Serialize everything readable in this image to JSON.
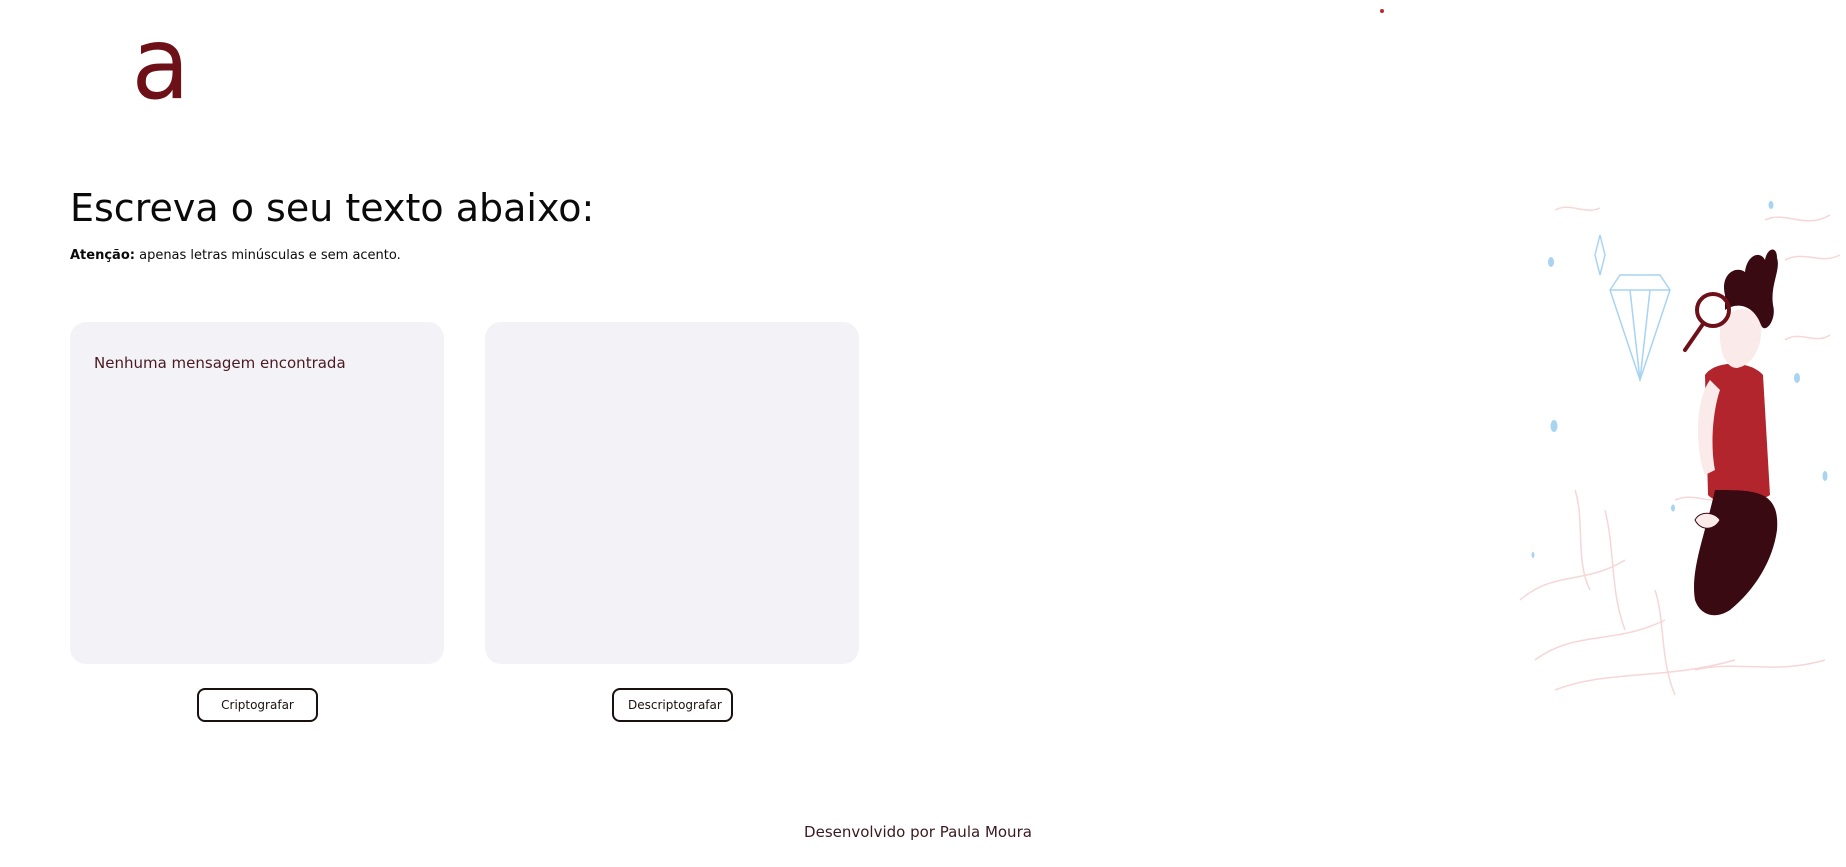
{
  "logo": {
    "text": "a"
  },
  "main": {
    "title": "Escreva o seu texto abaixo:",
    "notice_label": "Atenção:",
    "notice_text": " apenas letras minúsculas e sem acento."
  },
  "panels": {
    "left_text": "Nenhuma mensagem encontrada",
    "right_text": ""
  },
  "buttons": {
    "encrypt": "Criptografar",
    "decrypt": "Descriptografar"
  },
  "footer": {
    "text": "Desenvolvido por Paula Moura"
  },
  "colors": {
    "brand": "#6e1018",
    "panel_bg": "#f3f3f7",
    "shirt": "#b2252c",
    "pants": "#3a0a12"
  },
  "icons": {
    "illustration": "person-with-magnifying-glass-illustration"
  }
}
